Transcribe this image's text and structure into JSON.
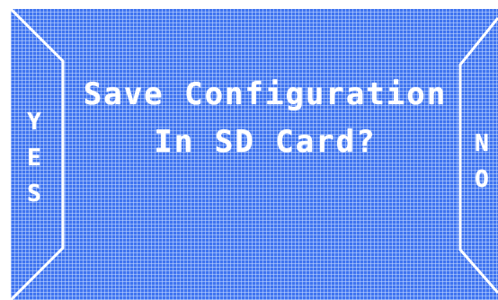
{
  "dialog": {
    "title_line_1": "Save Configuration",
    "title_line_2": "In SD Card?"
  },
  "yes_button": {
    "letters": [
      "Y",
      "E",
      "S"
    ]
  },
  "no_button": {
    "letters": [
      "N",
      "O"
    ]
  },
  "colors": {
    "screen_background": "#3f74f0",
    "grid": "#c8dcff",
    "text": "#ffffff"
  }
}
